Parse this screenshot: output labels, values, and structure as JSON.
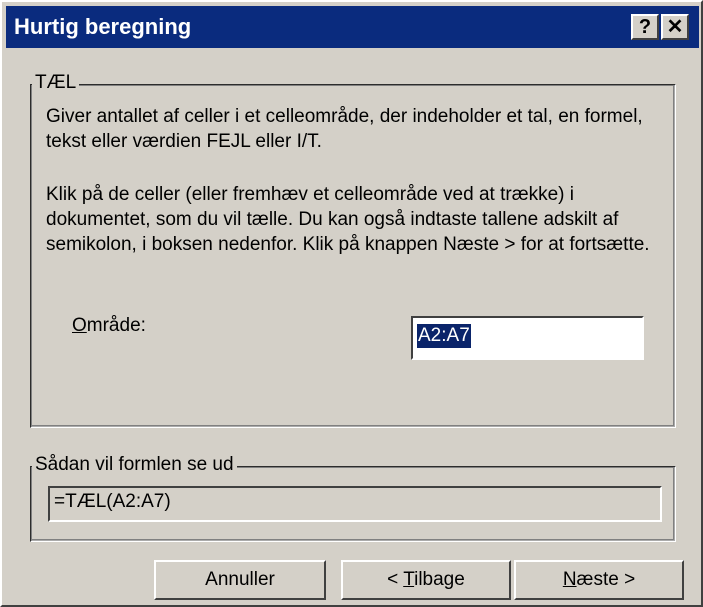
{
  "window": {
    "title": "Hurtig beregning",
    "help_glyph": "?",
    "close_glyph": "✕"
  },
  "function_group": {
    "legend": "TÆL",
    "description": "Giver antallet af celler i et celleområde, der indeholder et tal, en formel, tekst eller værdien FEJL eller I/T.",
    "instructions": "Klik på de celler (eller fremhæv et celleområde ved at trække) i dokumentet, som du vil tælle. Du kan også indtaste tallene adskilt af semikolon, i boksen nedenfor. Klik på knappen Næste > for at fortsætte.",
    "range_label_mnemonic": "O",
    "range_label_rest": "mråde:",
    "range_value": "A2:A7"
  },
  "formula_group": {
    "legend": "Sådan vil formlen se ud",
    "formula": "=TÆL(A2:A7)"
  },
  "buttons": {
    "cancel": "Annuller",
    "back_prefix": "< ",
    "back_mnemonic": "T",
    "back_rest": "ilbage",
    "next_mnemonic": "N",
    "next_rest": "æste >"
  },
  "colors": {
    "title_bar": "#0a2b7e",
    "dialog_face": "#d4d0c8",
    "selection": "#0a246a"
  }
}
